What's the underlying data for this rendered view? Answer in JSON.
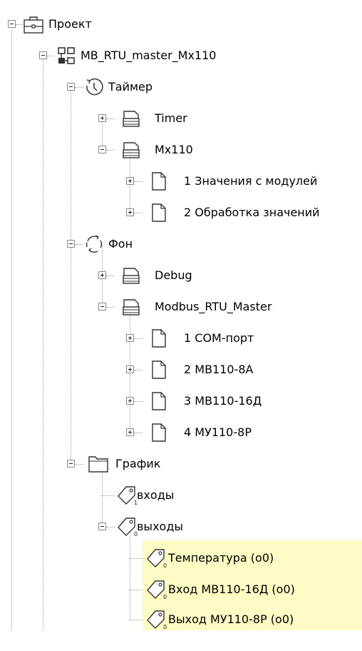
{
  "tree": {
    "root": {
      "label": "Проект",
      "icon": "briefcase-icon"
    },
    "project": {
      "label": "MB_RTU_master_Mx110",
      "icon": "network-blocks-icon"
    },
    "timer_task": {
      "label": "Таймер",
      "icon": "clock-icon"
    },
    "timer_sheet": {
      "label": "Timer",
      "icon": "page-stack-icon"
    },
    "mx110_sheet": {
      "label": "Mx110",
      "icon": "page-stack-icon"
    },
    "page_values": {
      "label": "1 Значения с модулей",
      "icon": "page-icon"
    },
    "page_processing": {
      "label": "2 Обработка значений",
      "icon": "page-icon"
    },
    "background_task": {
      "label": "Фон",
      "icon": "cycle-arrows-icon"
    },
    "debug_sheet": {
      "label": "Debug",
      "icon": "page-stack-icon"
    },
    "modbus_sheet": {
      "label": "Modbus_RTU_Master",
      "icon": "page-stack-icon"
    },
    "page_com": {
      "label": "1 COM-порт",
      "icon": "page-icon"
    },
    "page_mv8a": {
      "label": "2 МВ110-8А",
      "icon": "page-icon"
    },
    "page_mv16d": {
      "label": "3 МВ110-16Д",
      "icon": "page-icon"
    },
    "page_mu8r": {
      "label": "4 МУ110-8Р",
      "icon": "page-icon"
    },
    "chart_folder": {
      "label": "График",
      "icon": "folder-icon"
    },
    "inputs_group": {
      "label": "входы",
      "icon": "tag-icon",
      "tag_index": "1"
    },
    "outputs_group": {
      "label": "выходы",
      "icon": "tag-icon",
      "tag_index": "0"
    },
    "var_temperature": {
      "label": "Температура  (o0)",
      "icon": "tag-icon",
      "tag_index": "0"
    },
    "var_input16d": {
      "label": "Вход МВ110-16Д  (o0)",
      "icon": "tag-icon",
      "tag_index": "0"
    },
    "var_output8r": {
      "label": "Выход МУ110-8Р  (o0)",
      "icon": "tag-icon",
      "tag_index": "0"
    }
  },
  "colors": {
    "highlight": "#fefbc4",
    "connector": "#9a9a9a"
  }
}
